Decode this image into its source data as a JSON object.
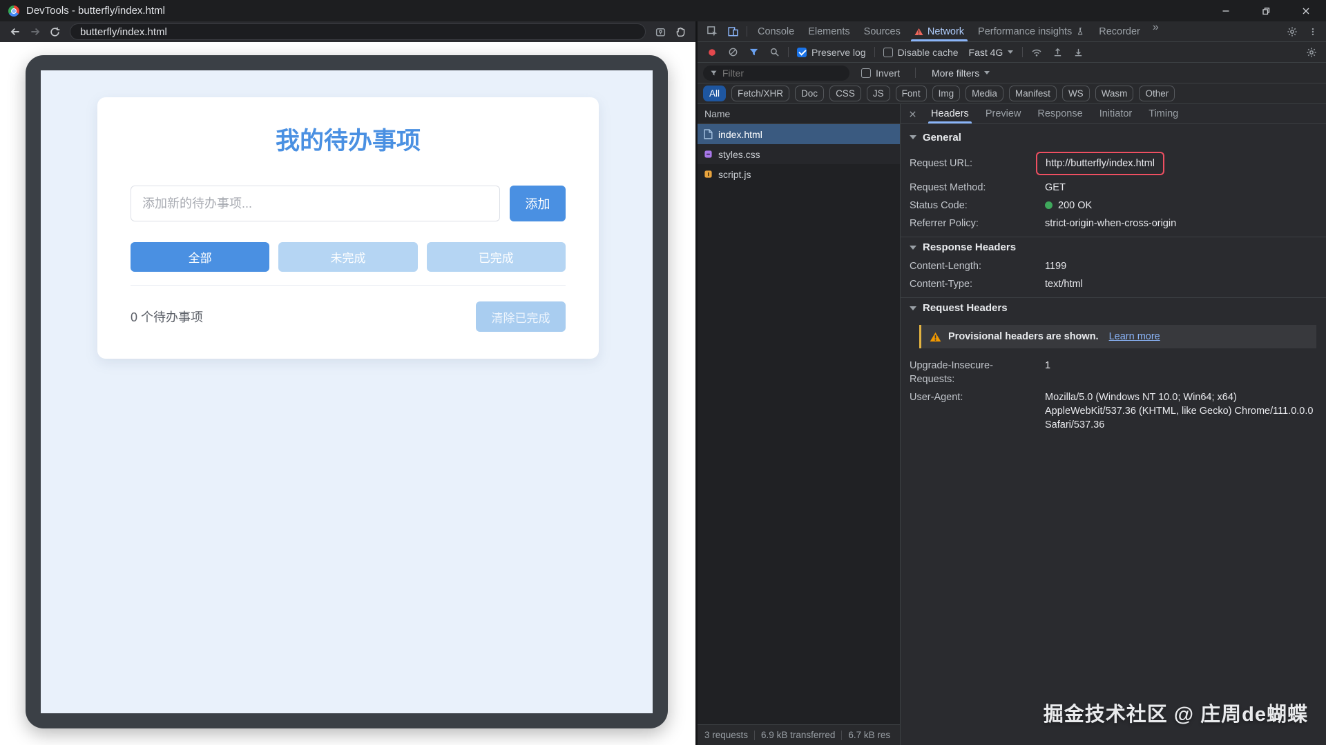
{
  "window": {
    "title": "DevTools - butterfly/index.html"
  },
  "browser": {
    "address": "butterfly/index.html"
  },
  "todo_app": {
    "title": "我的待办事项",
    "input_placeholder": "添加新的待办事项...",
    "add_button": "添加",
    "filter_all": "全部",
    "filter_active": "未完成",
    "filter_done": "已完成",
    "count_text": "0 个待办事项",
    "clear_button": "清除已完成"
  },
  "devtools": {
    "tabs": {
      "console": "Console",
      "elements": "Elements",
      "sources": "Sources",
      "network": "Network",
      "performance_insights": "Performance insights",
      "recorder": "Recorder",
      "more": "»"
    },
    "toolbar": {
      "preserve_log": "Preserve log",
      "disable_cache": "Disable cache",
      "throttling": "Fast 4G"
    },
    "filter_bar": {
      "filter_placeholder": "Filter",
      "invert": "Invert",
      "more_filters": "More filters"
    },
    "chips": [
      "All",
      "Fetch/XHR",
      "Doc",
      "CSS",
      "JS",
      "Font",
      "Img",
      "Media",
      "Manifest",
      "WS",
      "Wasm",
      "Other"
    ],
    "request_list": {
      "column_name": "Name",
      "rows": [
        {
          "name": "index.html"
        },
        {
          "name": "styles.css"
        },
        {
          "name": "script.js"
        }
      ]
    },
    "detail_tabs": {
      "headers": "Headers",
      "preview": "Preview",
      "response": "Response",
      "initiator": "Initiator",
      "timing": "Timing"
    },
    "headers_pane": {
      "general_title": "General",
      "general": [
        {
          "label": "Request URL:",
          "value": "http://butterfly/index.html"
        },
        {
          "label": "Request Method:",
          "value": "GET"
        },
        {
          "label": "Status Code:",
          "value": "200 OK"
        },
        {
          "label": "Referrer Policy:",
          "value": "strict-origin-when-cross-origin"
        }
      ],
      "response_title": "Response Headers",
      "response": [
        {
          "label": "Content-Length:",
          "value": "1199"
        },
        {
          "label": "Content-Type:",
          "value": "text/html"
        }
      ],
      "request_title": "Request Headers",
      "warning_text": "Provisional headers are shown.",
      "warning_link": "Learn more",
      "request": [
        {
          "label": "Upgrade-Insecure-Requests:",
          "value": "1"
        },
        {
          "label": "User-Agent:",
          "value": "Mozilla/5.0 (Windows NT 10.0; Win64; x64) AppleWebKit/537.36 (KHTML, like Gecko) Chrome/111.0.0.0 Safari/537.36"
        }
      ]
    },
    "status_bar": {
      "requests": "3 requests",
      "transferred": "6.9 kB transferred",
      "resources": "6.7 kB res"
    }
  },
  "watermark": "掘金技术社区 @ 庄周de蝴蝶",
  "colors": {
    "accent_blue": "#4a90e2",
    "devtools_accent": "#8ab4f8",
    "highlight_red": "#ee4f61",
    "status_green": "#3fa85c"
  }
}
